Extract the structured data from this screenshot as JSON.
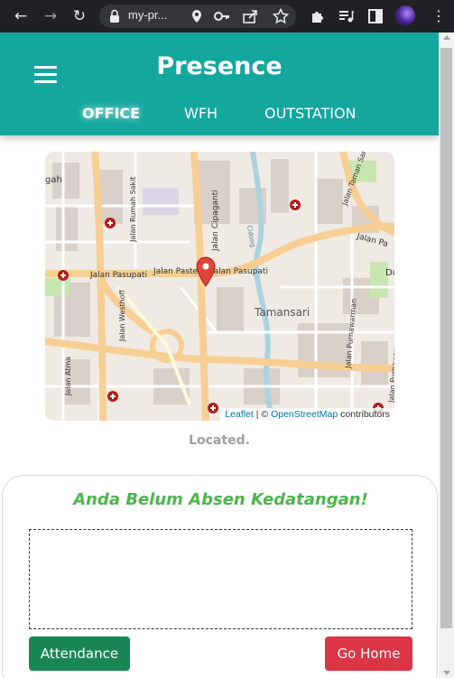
{
  "browser": {
    "url": "my-pr...",
    "back_icon": "arrow-left-icon",
    "forward_icon": "arrow-right-icon",
    "reload_icon": "reload-icon"
  },
  "app": {
    "title": "Presence",
    "tabs": [
      {
        "label": "OFFICE",
        "active": true
      },
      {
        "label": "WFH",
        "active": false
      },
      {
        "label": "OUTSTATION",
        "active": false
      }
    ],
    "header_color": "#13a79e"
  },
  "map": {
    "labels": {
      "jalan_pasupati_1": "Jalan Pasupati",
      "jalan_pasupati_2": "Jalan Paste",
      "jalan_pasupati_3": "Jalan Pasupati",
      "jalan_cipaganti": "Jalan Cipaganti",
      "jalan_rumah_sakit": "Jalan Rumah Sakit",
      "jalan_westhoff": "Jalan Westhoff",
      "jalan_taman_sari": "Jalan Taman Sari",
      "jalan_pa": "Jalan Pa",
      "jalan_purnawarman_a": "Jalan Purnawarman",
      "jalan_purnawarman_b": "Jalan Purnawarman",
      "jalan_atma": "Jalan Atma",
      "tamansari": "Tamansari",
      "cidong": "Cidong",
      "dk_left": "gah",
      "du_right": "Du"
    },
    "attribution": {
      "leaflet": "Leaflet",
      "separator": "| ©",
      "osm": "OpenStreetMap",
      "suffix": "contributors"
    }
  },
  "status": {
    "located": "Located."
  },
  "attendance_card": {
    "notice": "Anda Belum Absen Kedatangan!",
    "attendance_button": "Attendance",
    "home_button": "Go Home"
  }
}
